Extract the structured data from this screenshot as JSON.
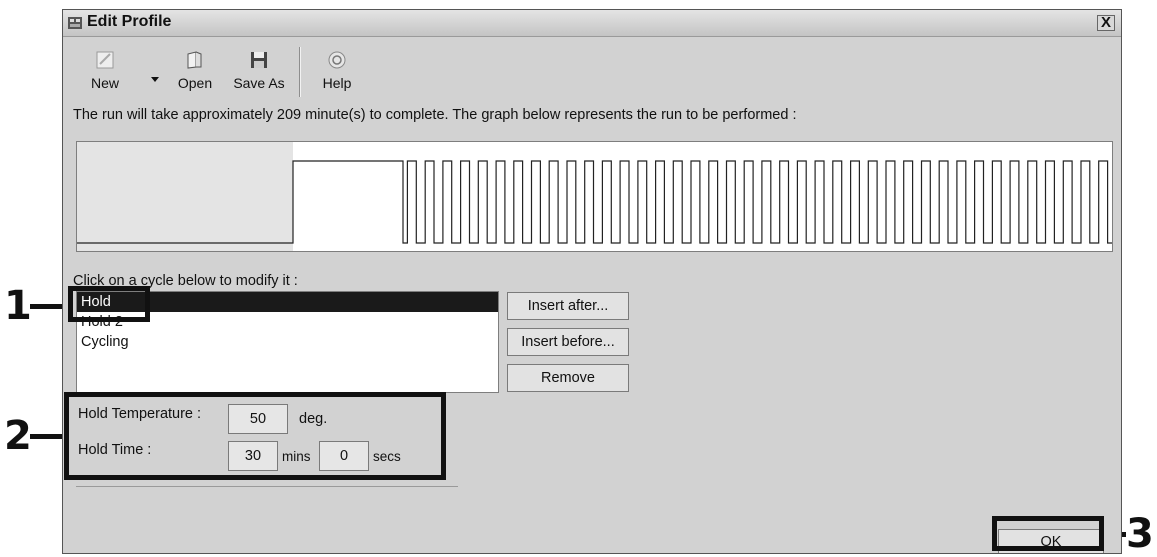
{
  "window": {
    "title": "Edit Profile",
    "close_label": "X"
  },
  "toolbar": {
    "new_label": "New",
    "open_label": "Open",
    "save_as_label": "Save As",
    "help_label": "Help"
  },
  "info_text": "The run will take approximately 209 minute(s) to complete. The graph below represents the run to be performed :",
  "cycle_prompt": "Click on a cycle below to modify it :",
  "cycles": [
    {
      "label": "Hold",
      "selected": true
    },
    {
      "label": "Hold 2",
      "selected": false
    },
    {
      "label": "Cycling",
      "selected": false
    }
  ],
  "side_buttons": {
    "insert_after": "Insert after...",
    "insert_before": "Insert before...",
    "remove": "Remove"
  },
  "params": {
    "hold_temperature_label": "Hold Temperature :",
    "hold_temperature_value": "50",
    "temp_unit": "deg.",
    "hold_time_label": "Hold Time :",
    "hold_time_mins": "30",
    "mins_unit": "mins",
    "hold_time_secs": "0",
    "secs_unit": "secs"
  },
  "ok_label": "OK",
  "callouts": [
    "1",
    "2",
    "3"
  ],
  "profile_graph": {
    "segments": [
      "Hold",
      "Hold 2",
      "Cycling"
    ],
    "cycling_pulses": 40
  }
}
